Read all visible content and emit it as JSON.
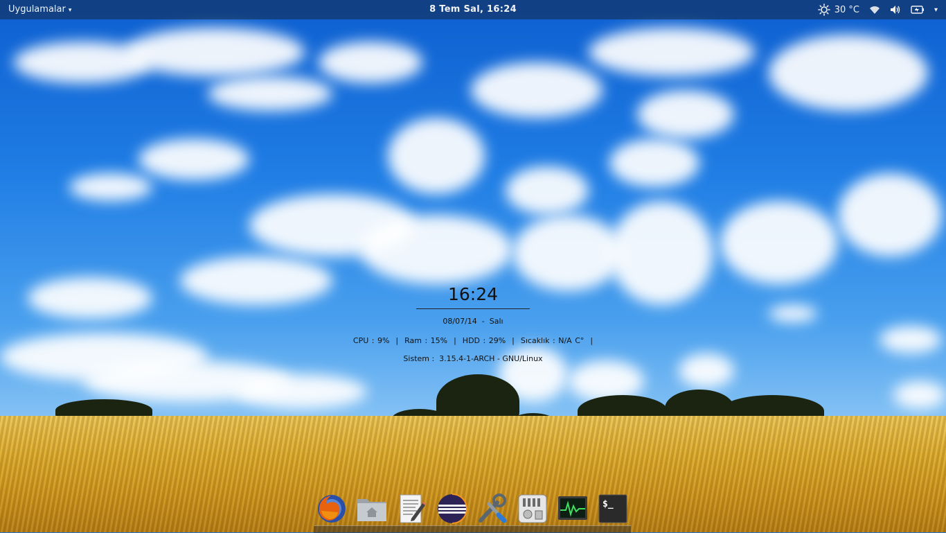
{
  "topbar": {
    "apps_label": "Uygulamalar",
    "clock": "8 Tem Sal, 16:24",
    "weather_temp": "30 °C"
  },
  "conky": {
    "time": "16:24",
    "date_line": "08/07/14  -  Salı",
    "stats_line": "CPU : 9%  |  Ram : 15%  |  HDD : 29%  |  Sıcaklık : N/A C°  |",
    "system_line": "Sistem :  3.15.4-1-ARCH - GNU/Linux"
  },
  "dock": {
    "items": [
      {
        "icon": "firefox-icon"
      },
      {
        "icon": "home-folder-icon"
      },
      {
        "icon": "text-editor-icon"
      },
      {
        "icon": "eclipse-icon"
      },
      {
        "icon": "system-tools-icon"
      },
      {
        "icon": "mixer-settings-icon"
      },
      {
        "icon": "system-monitor-icon"
      },
      {
        "icon": "terminal-icon"
      }
    ]
  },
  "colors": {
    "sky": "#1d73d8",
    "field": "#d9a92e",
    "topbar_text": "#f2f2f2"
  }
}
